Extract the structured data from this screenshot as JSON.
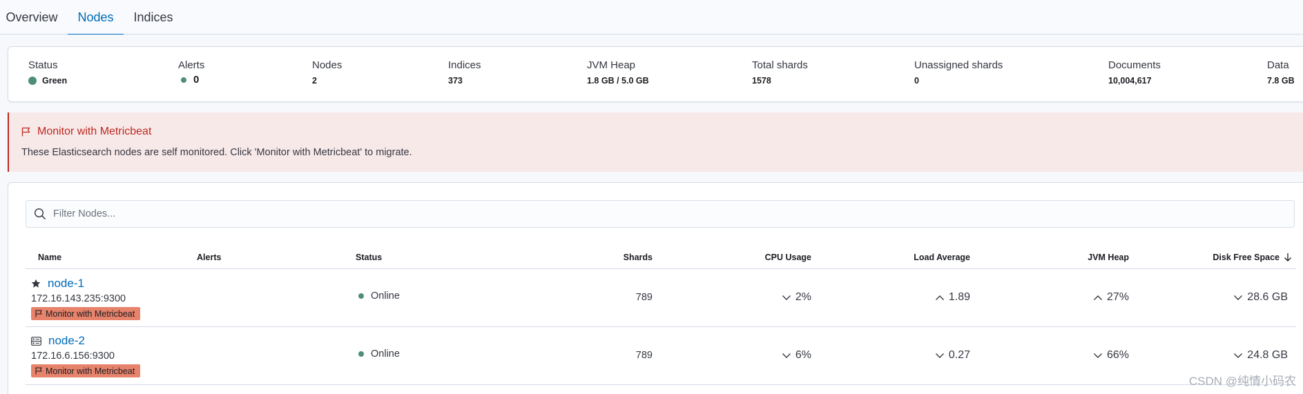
{
  "tabs": [
    {
      "label": "Overview",
      "active": false
    },
    {
      "label": "Nodes",
      "active": true
    },
    {
      "label": "Indices",
      "active": false
    }
  ],
  "summary": {
    "status": {
      "label": "Status",
      "value": "Green"
    },
    "alerts": {
      "label": "Alerts",
      "value": "0"
    },
    "nodes": {
      "label": "Nodes",
      "value": "2"
    },
    "indices": {
      "label": "Indices",
      "value": "373"
    },
    "jvm_heap": {
      "label": "JVM Heap",
      "value": "1.8 GB / 5.0 GB"
    },
    "total_shards": {
      "label": "Total shards",
      "value": "1578"
    },
    "unassigned_shards": {
      "label": "Unassigned shards",
      "value": "0"
    },
    "documents": {
      "label": "Documents",
      "value": "10,004,617"
    },
    "data": {
      "label": "Data",
      "value": "7.8 GB"
    }
  },
  "callout": {
    "title": "Monitor with Metricbeat",
    "text": "These Elasticsearch nodes are self monitored. Click 'Monitor with Metricbeat' to migrate."
  },
  "search": {
    "placeholder": "Filter Nodes..."
  },
  "table": {
    "headers": {
      "name": "Name",
      "alerts": "Alerts",
      "status": "Status",
      "shards": "Shards",
      "cpu": "CPU Usage",
      "load": "Load Average",
      "jvm": "JVM Heap",
      "disk": "Disk Free Space"
    },
    "rows": [
      {
        "icon": "star-icon",
        "name": "node-1",
        "address": "172.16.143.235:9300",
        "badge": "Monitor with Metricbeat",
        "status": "Online",
        "shards": "789",
        "cpu": "2%",
        "cpu_trend": "down",
        "load": "1.89",
        "load_trend": "up",
        "jvm": "27%",
        "jvm_trend": "up",
        "disk": "28.6 GB",
        "disk_trend": "down"
      },
      {
        "icon": "server-icon",
        "name": "node-2",
        "address": "172.16.6.156:9300",
        "badge": "Monitor with Metricbeat",
        "status": "Online",
        "shards": "789",
        "cpu": "6%",
        "cpu_trend": "down",
        "load": "0.27",
        "load_trend": "down",
        "jvm": "66%",
        "jvm_trend": "down",
        "disk": "24.8 GB",
        "disk_trend": "down"
      }
    ]
  },
  "watermark": "CSDN @纯情小码农",
  "colors": {
    "accent": "#006bb8",
    "danger": "#bd271e",
    "success": "#4e8d7a",
    "badge": "#e7826b"
  }
}
